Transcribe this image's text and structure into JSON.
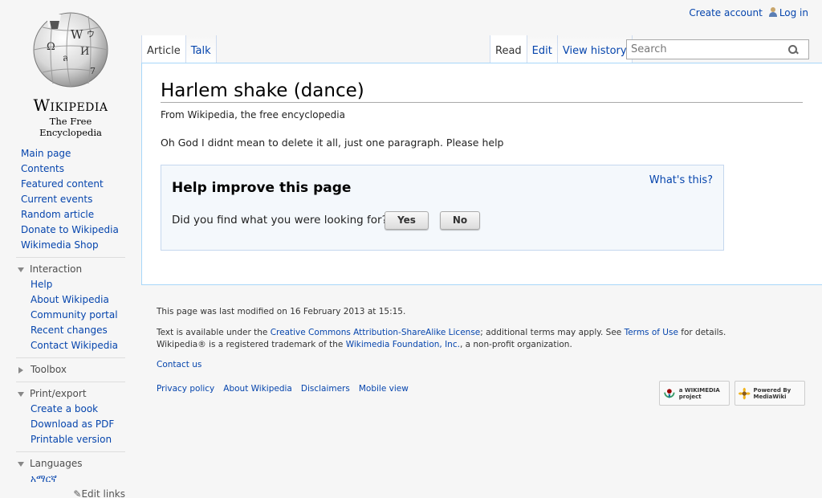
{
  "personal": {
    "create_account": "Create account",
    "login": "Log in"
  },
  "logo": {
    "wordmark": "Wikipedia",
    "tagline": "The Free Encyclopedia"
  },
  "nav": {
    "main": [
      "Main page",
      "Contents",
      "Featured content",
      "Current events",
      "Random article",
      "Donate to Wikipedia",
      "Wikimedia Shop"
    ],
    "interaction": {
      "heading": "Interaction",
      "items": [
        "Help",
        "About Wikipedia",
        "Community portal",
        "Recent changes",
        "Contact Wikipedia"
      ]
    },
    "toolbox": {
      "heading": "Toolbox"
    },
    "print": {
      "heading": "Print/export",
      "items": [
        "Create a book",
        "Download as PDF",
        "Printable version"
      ]
    },
    "languages": {
      "heading": "Languages",
      "items": [
        "አማርኛ"
      ],
      "edit_links": "Edit links"
    }
  },
  "tabs": {
    "left": [
      "Article",
      "Talk"
    ],
    "right": [
      "Read",
      "Edit",
      "View history"
    ]
  },
  "search": {
    "placeholder": "Search"
  },
  "article": {
    "title": "Harlem shake (dance)",
    "site_sub": "From Wikipedia, the free encyclopedia",
    "body": "Oh God I didnt mean to delete it all, just one paragraph. Please help"
  },
  "feedback": {
    "heading": "Help improve this page",
    "whats_this": "What's this?",
    "question": "Did you find what you were looking for?",
    "yes": "Yes",
    "no": "No"
  },
  "footer": {
    "last_modified": "This page was last modified on 16 February 2013 at 15:15.",
    "license_1a": "Text is available under the ",
    "license_link": "Creative Commons Attribution-ShareAlike License",
    "license_1b": "; additional terms may apply. See ",
    "terms_link": "Terms of Use",
    "license_1c": " for details.",
    "trademark_a": "Wikipedia® is a registered trademark of the ",
    "foundation_link": "Wikimedia Foundation, Inc.",
    "trademark_b": ", a non-profit organization.",
    "contact": "Contact us",
    "places": [
      "Privacy policy",
      "About Wikipedia",
      "Disclaimers",
      "Mobile view"
    ],
    "badge_wikimedia": "a WIKIMEDIA project",
    "badge_mediawiki": "Powered By MediaWiki"
  },
  "colors": {
    "link": "#0645ad",
    "content_border": "#a7d7f9",
    "background": "#f6f6f6"
  }
}
